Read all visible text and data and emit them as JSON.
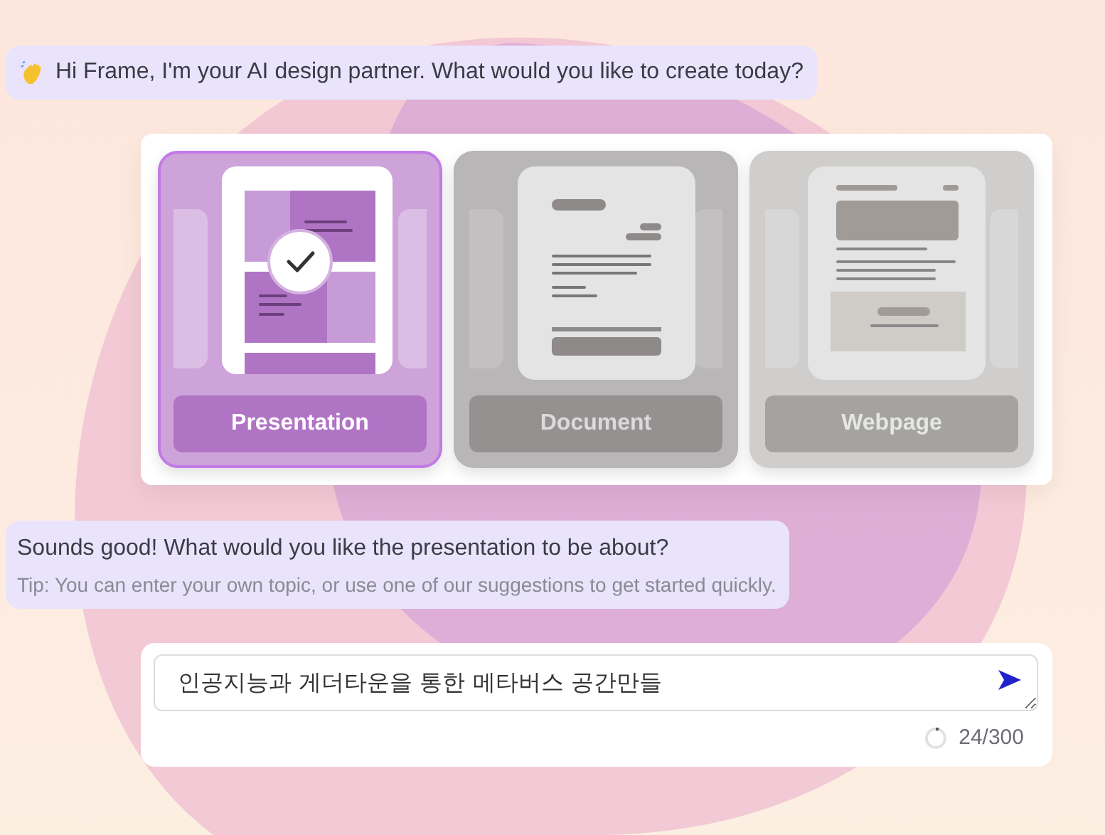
{
  "greeting": {
    "text": "Hi Frame, I'm your AI design partner. What would you like to create today?"
  },
  "formats": [
    {
      "kind": "presentation",
      "label": "Presentation",
      "selected": true
    },
    {
      "kind": "document",
      "label": "Document",
      "selected": false
    },
    {
      "kind": "webpage",
      "label": "Webpage",
      "selected": false
    }
  ],
  "reply": {
    "text": "Sounds good! What would you like the presentation to be about?",
    "tip": "Tip: You can enter your own topic, or use one of our suggestions to get started quickly."
  },
  "prompt": {
    "value": "인공지능과 게더타운을 통한 메타버스 공간만들",
    "counter": "24/300"
  }
}
